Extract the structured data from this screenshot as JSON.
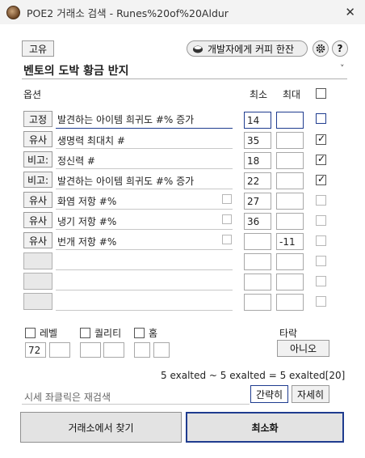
{
  "window": {
    "title": "POE2 거래소 검색 - Runes%20of%20Aldur",
    "close_glyph": "✕"
  },
  "toolbar": {
    "rarity_button": "고유",
    "coffee_button": "개발자에게 커피 한잔",
    "help_glyph": "?"
  },
  "item": {
    "name": "벤토의 도박 황금 반지",
    "dropdown_glyph": "˅"
  },
  "columns": {
    "options": "옵션",
    "min": "최소",
    "max": "최대"
  },
  "stats": [
    {
      "mode": "고정",
      "text": "발견하는 아이템 희귀도 #% 증가",
      "min": "14",
      "max": "",
      "enabled": false
    },
    {
      "mode": "유사",
      "text": "생명력 최대치 #",
      "min": "35",
      "max": "",
      "enabled": true
    },
    {
      "mode": "비고:",
      "text": "정신력 #",
      "min": "18",
      "max": "",
      "enabled": true
    },
    {
      "mode": "비고:",
      "text": "발견하는 아이템 희귀도 #% 증가",
      "min": "22",
      "max": "",
      "enabled": true
    },
    {
      "mode": "유사",
      "text": "화염 저항 #%",
      "min": "27",
      "max": "",
      "enabled": false
    },
    {
      "mode": "유사",
      "text": "냉기 저항 #%",
      "min": "36",
      "max": "",
      "enabled": false
    },
    {
      "mode": "유사",
      "text": "번개 저항 #%",
      "min": "",
      "max": "-11",
      "enabled": false
    },
    {
      "mode": "",
      "text": "",
      "min": "",
      "max": "",
      "enabled": false
    },
    {
      "mode": "",
      "text": "",
      "min": "",
      "max": "",
      "enabled": false
    },
    {
      "mode": "",
      "text": "",
      "min": "",
      "max": "",
      "enabled": false
    }
  ],
  "filters": {
    "level": {
      "label": "레벨",
      "min": "72",
      "max": ""
    },
    "quality": {
      "label": "퀄리티",
      "min": "",
      "max": ""
    },
    "sockets": {
      "label": "홈",
      "min": "",
      "max": ""
    },
    "corrupted": {
      "label": "타락",
      "value": "아니오"
    }
  },
  "price_summary": "5 exalted ~ 5 exalted = 5 exalted[20]",
  "hint": "시세 좌클릭은 재검색",
  "view_buttons": {
    "simple": "간략히",
    "detail": "자세히"
  },
  "actions": {
    "search_trade": "거래소에서 찾기",
    "minimize": "최소화"
  }
}
